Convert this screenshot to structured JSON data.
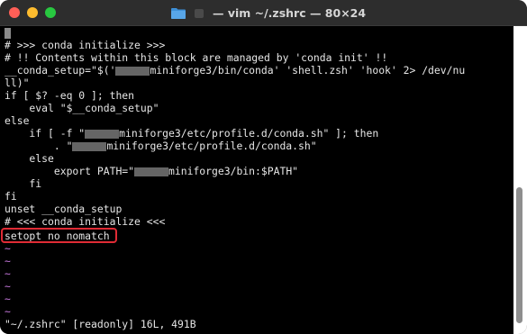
{
  "window": {
    "title": "— vim ~/.zshrc — 80×24",
    "icons": [
      "folder-icon",
      "document-icon"
    ]
  },
  "editor": {
    "lines": [
      "# >>> conda initialize >>>",
      "# !! Contents within this block are managed by 'conda init' !!",
      "__conda_setup=\"$('",
      "miniforge3/bin/conda' 'shell.zsh' 'hook' 2> /dev/nu",
      "ll)\"",
      "if [ $? -eq 0 ]; then",
      "    eval \"$__conda_setup\"",
      "else",
      "    if [ -f \"",
      "miniforge3/etc/profile.d/conda.sh\" ]; then",
      "        . \"",
      "miniforge3/etc/profile.d/conda.sh\"",
      "    else",
      "        export PATH=\"",
      "miniforge3/bin:$PATH\"",
      "    fi",
      "fi",
      "unset __conda_setup",
      "# <<< conda initialize <<<",
      "setopt no_nomatch"
    ],
    "tildes": [
      "~",
      "~",
      "~",
      "~",
      "~",
      "~"
    ],
    "status_line": "\"~/.zshrc\" [readonly] 16L, 491B"
  },
  "colors": {
    "tilde": "#c678dd",
    "highlight_box": "#e02b35"
  }
}
